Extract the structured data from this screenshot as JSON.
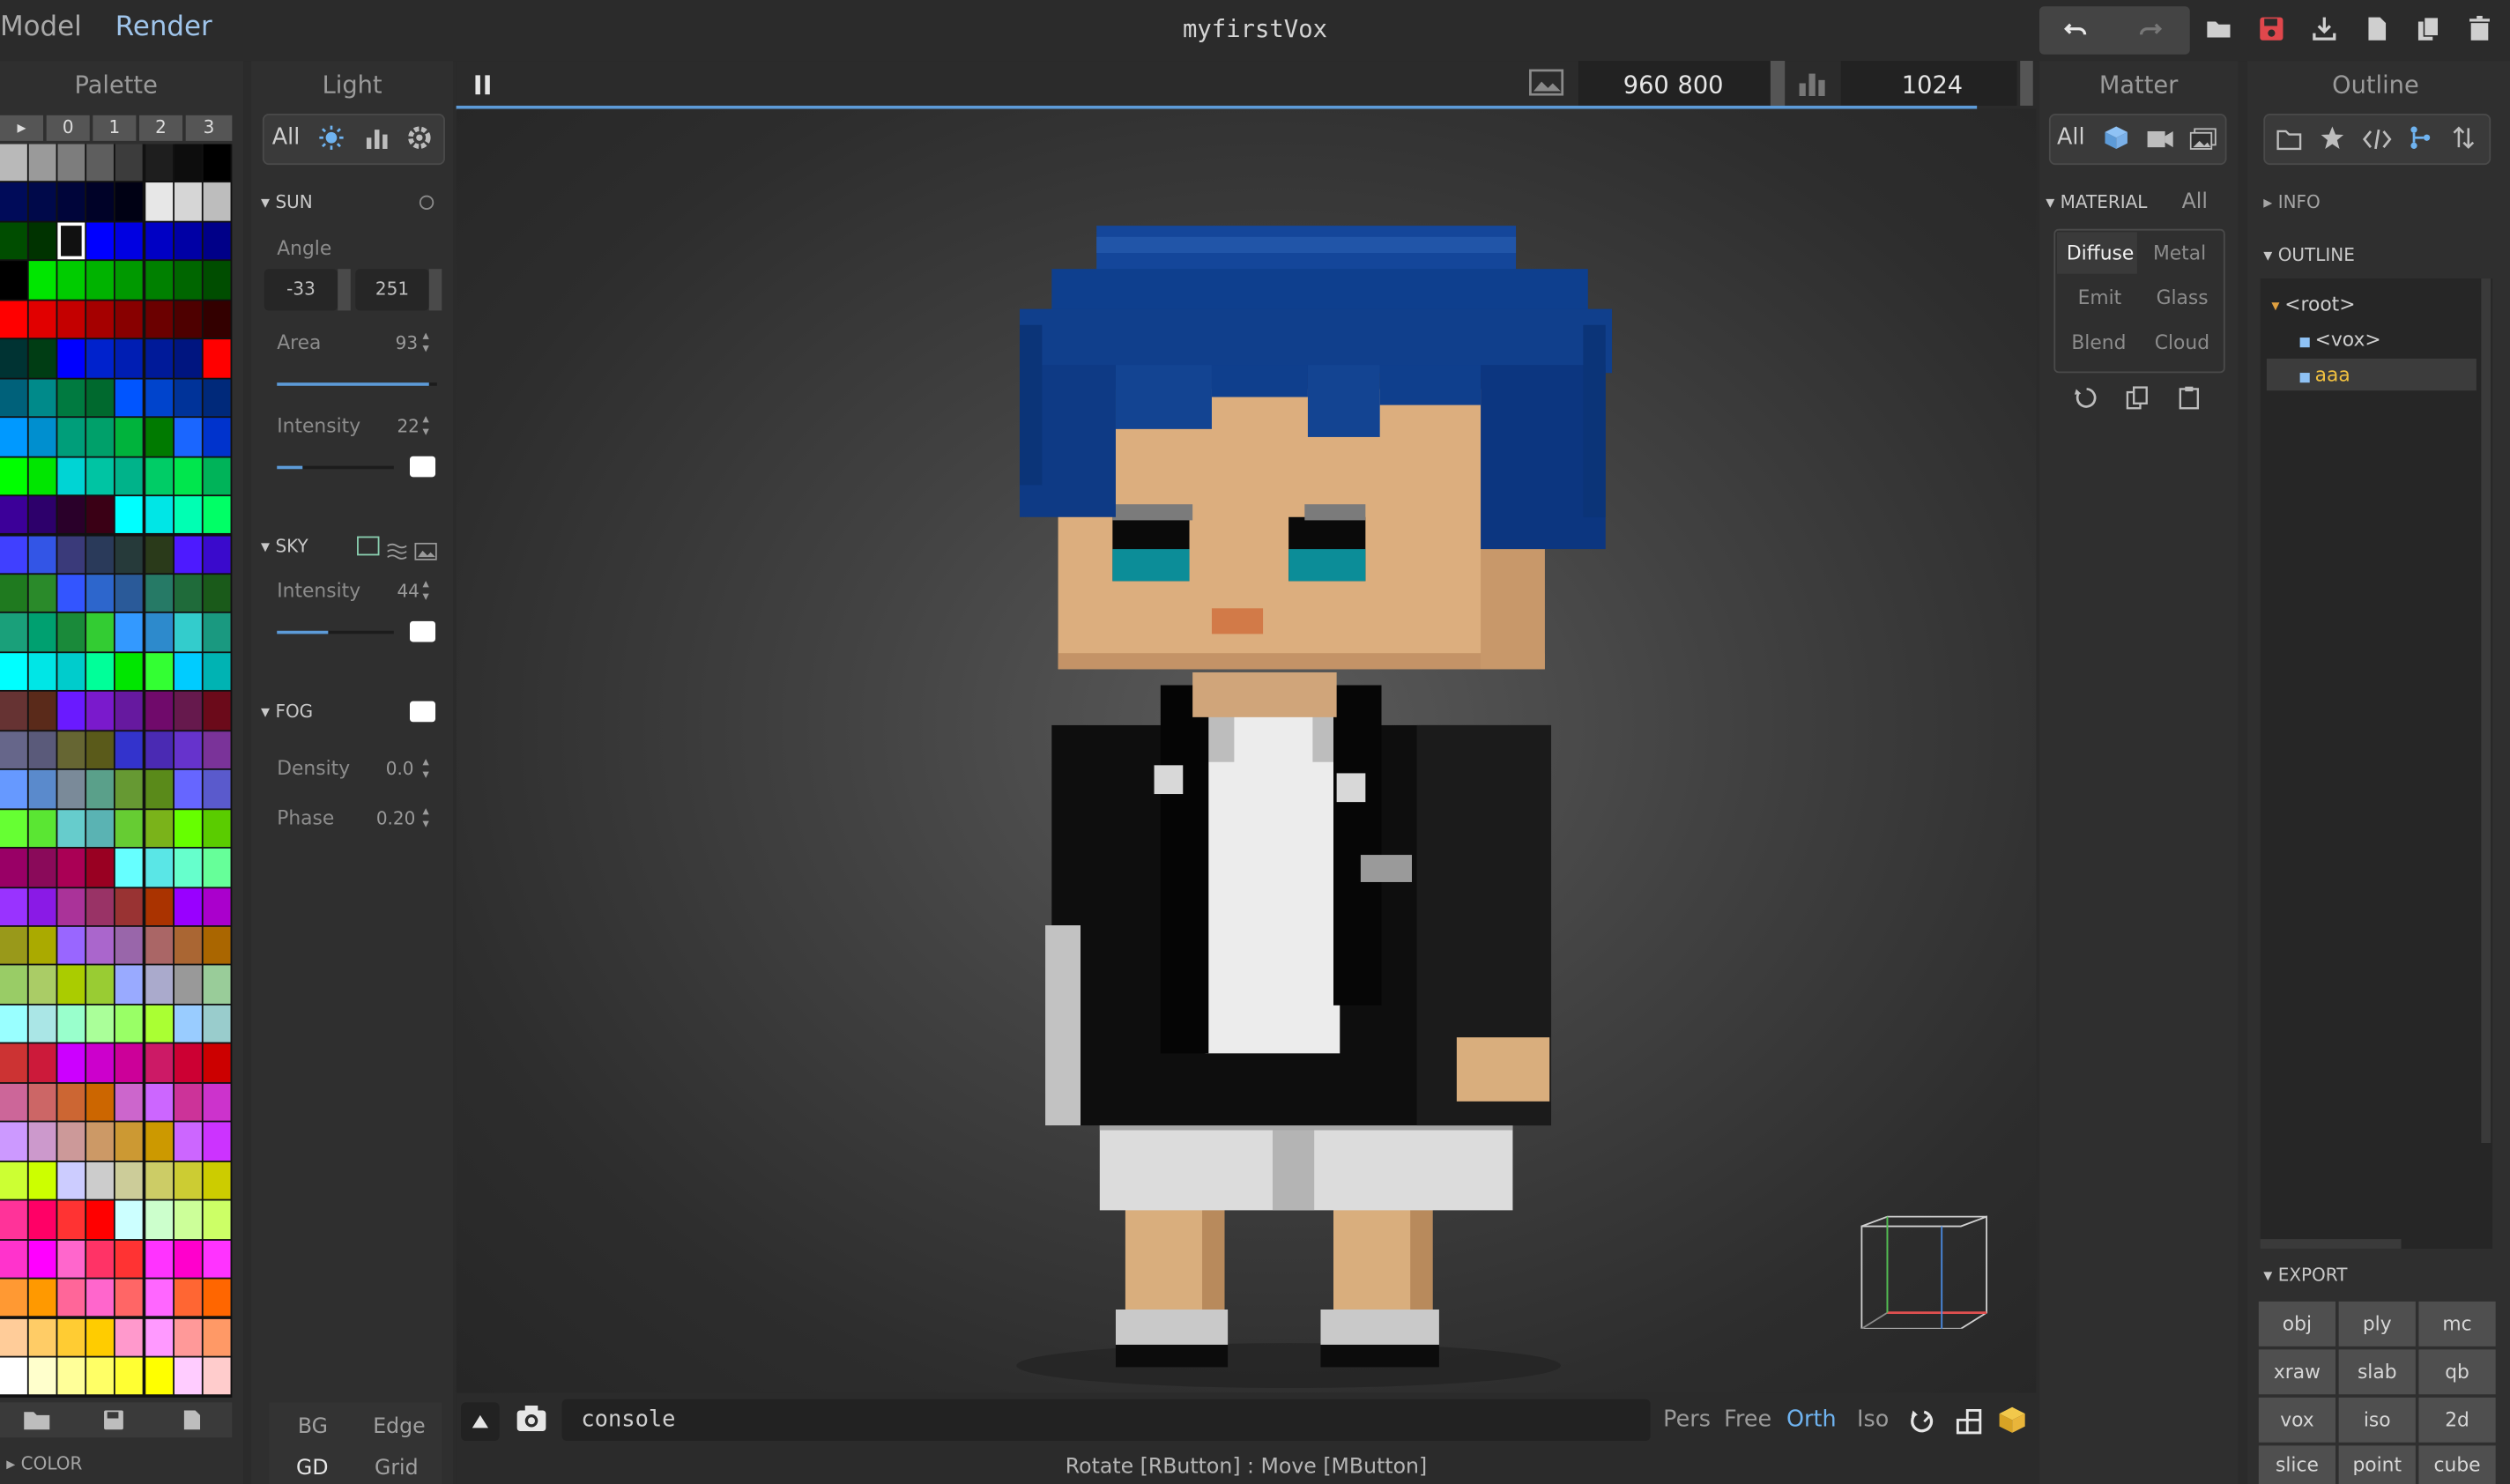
{
  "menu": {
    "model": "Model",
    "render": "Render"
  },
  "doc_title": "myfirstVox",
  "toolbar": {
    "undo_icon": "undo-icon",
    "redo_icon": "redo-icon",
    "open_icon": "folder-open-icon",
    "save_icon": "save-icon",
    "import_icon": "download-icon",
    "new_icon": "new-file-icon",
    "copy_icon": "copy-file-icon",
    "delete_icon": "trash-icon",
    "save_color": "#e0474c"
  },
  "palette": {
    "title": "Palette",
    "tabs": [
      "▸",
      "0",
      "1",
      "2",
      "3"
    ],
    "selected_index": 18,
    "colors": [
      "#b9b9b9",
      "#9a9a9a",
      "#7d7d7d",
      "#5e5e5e",
      "#3c3c3c",
      "#1e1e1e",
      "#0d0d0d",
      "#000000",
      "#000b59",
      "#00094a",
      "#00053a",
      "#000228",
      "#000114",
      "#e7e7e7",
      "#d6d6d6",
      "#bdbdbd",
      "#004d00",
      "#003300",
      "#111111",
      "#0000ff",
      "#0000e1",
      "#0000c4",
      "#0000a5",
      "#000088",
      "#000000",
      "#00e600",
      "#00cc00",
      "#00b300",
      "#009900",
      "#008000",
      "#006600",
      "#004d00",
      "#ff0000",
      "#e10000",
      "#c40000",
      "#a50000",
      "#880000",
      "#6b0000",
      "#4e0000",
      "#330000",
      "#003333",
      "#003d14",
      "#0000ff",
      "#0022cc",
      "#001eb3",
      "#001a99",
      "#001580",
      "#ff0000",
      "#00617a",
      "#008a8a",
      "#007a40",
      "#00692e",
      "#0055ff",
      "#0044cc",
      "#003399",
      "#00297a",
      "#0099ff",
      "#008fcf",
      "#009e7a",
      "#00a06a",
      "#00b33c",
      "#007a00",
      "#1a66ff",
      "#0033cc",
      "#00ff00",
      "#00e600",
      "#00d4d4",
      "#00c4a3",
      "#00b38a",
      "#00cc66",
      "#00e64d",
      "#00b359",
      "#3c0099",
      "#2d006b",
      "#2a002a",
      "#3a0015",
      "#00ffff",
      "#00e6e6",
      "#00ffb3",
      "#00ff66",
      "#4040ff",
      "#3355e6",
      "#3a3a7a",
      "#2a3a5a",
      "#263a3a",
      "#2a3a1a",
      "#4d1aff",
      "#3a0acc",
      "#1f7a1f",
      "#2a8a2a",
      "#3355ff",
      "#2d66cc",
      "#2a5a99",
      "#267a66",
      "#1f6b3a",
      "#1a5a1a",
      "#1aa07a",
      "#00a070",
      "#1a8a3a",
      "#33cc33",
      "#3399ff",
      "#2d8acc",
      "#33cccc",
      "#1a9980",
      "#00ffff",
      "#00e6e6",
      "#00cccc",
      "#00ff99",
      "#00e600",
      "#33ff33",
      "#00ccff",
      "#00b3b3",
      "#663333",
      "#5a2a1a",
      "#6a1aff",
      "#7a1acc",
      "#66199f",
      "#700a6b",
      "#66194d",
      "#6b0a1a",
      "#66668a",
      "#5a5a7a",
      "#666633",
      "#5a5a1a",
      "#3333cc",
      "#4a2ab3",
      "#6633cc",
      "#7a3399",
      "#6699ff",
      "#5a8acc",
      "#7a8a99",
      "#5aa08a",
      "#669933",
      "#5a8a1a",
      "#6666ff",
      "#5a5acc",
      "#66ff33",
      "#5ae633",
      "#66cccc",
      "#5ab3b3",
      "#66cc33",
      "#7ab31a",
      "#66ff00",
      "#5acc00",
      "#990066",
      "#8a0a5a",
      "#aa0055",
      "#990022",
      "#66ffff",
      "#5ae6e6",
      "#66ffcc",
      "#66ff99",
      "#9933ff",
      "#8a1ae6",
      "#aa3399",
      "#993366",
      "#993333",
      "#aa3300",
      "#9900ff",
      "#aa00cc",
      "#99991a",
      "#aaaa00",
      "#9966ff",
      "#aa66cc",
      "#9966aa",
      "#aa6666",
      "#aa6633",
      "#aa6600",
      "#99cc66",
      "#aacc66",
      "#aacc00",
      "#99cc33",
      "#99aaff",
      "#aaaacc",
      "#999999",
      "#99cc99",
      "#99ffff",
      "#aae6e6",
      "#99ffcc",
      "#aaff99",
      "#99ff66",
      "#aaff33",
      "#99ccff",
      "#99cccc",
      "#cc3333",
      "#cc1a3a",
      "#cc00ff",
      "#cc00cc",
      "#cc0099",
      "#cc1a66",
      "#cc0033",
      "#cc0000",
      "#cc6699",
      "#cc6666",
      "#cc6633",
      "#cc6600",
      "#cc66cc",
      "#cc66ff",
      "#cc3399",
      "#cc33cc",
      "#cc99ff",
      "#cc99cc",
      "#cc9999",
      "#cc9966",
      "#cc9933",
      "#cc9900",
      "#cc66ff",
      "#cc33ff",
      "#ccff33",
      "#ccff00",
      "#ccccff",
      "#cccccc",
      "#cccc99",
      "#cccc66",
      "#cccc33",
      "#cccc00",
      "#ff3399",
      "#ff0066",
      "#ff3333",
      "#ff0000",
      "#ccffff",
      "#ccffcc",
      "#ccff99",
      "#ccff66",
      "#ff33cc",
      "#ff00ff",
      "#ff66cc",
      "#ff3366",
      "#ff3333",
      "#ff33ff",
      "#ff00cc",
      "#ff33ff",
      "#ff9933",
      "#ff9900",
      "#ff6699",
      "#ff66cc",
      "#ff6666",
      "#ff66ff",
      "#ff6633",
      "#ff6600",
      "#ffcc99",
      "#ffcc66",
      "#ffcc33",
      "#ffcc00",
      "#ff99cc",
      "#ff99ff",
      "#ff9999",
      "#ff9966",
      "#ffffff",
      "#ffffcc",
      "#ffff99",
      "#ffff66",
      "#ffff33",
      "#ffff00",
      "#ffccff",
      "#ffcccc"
    ],
    "footer": {
      "open_icon": "folder-icon",
      "save_icon": "save-icon",
      "new_icon": "file-icon"
    },
    "section_color": "COLOR"
  },
  "light": {
    "title": "Light",
    "filter": {
      "all": "All",
      "sun_icon": "sun-icon",
      "chart_icon": "bar-chart-icon",
      "settings_icon": "gear-icon"
    },
    "sun": {
      "label": "SUN",
      "toggle_icon": "circle-icon",
      "angle_label": "Angle",
      "angle_a": "-33",
      "angle_b": "251",
      "area_label": "Area",
      "area_value": "93",
      "area_level": 0.95,
      "intensity_label": "Intensity",
      "intensity_value": "22",
      "intensity_level": 0.22
    },
    "sky": {
      "label": "SKY",
      "icons": [
        "square-icon",
        "waves-icon",
        "image-icon"
      ],
      "intensity_label": "Intensity",
      "intensity_value": "44",
      "intensity_level": 0.44
    },
    "fog": {
      "label": "FOG",
      "density_label": "Density",
      "density_value": "0.0",
      "phase_label": "Phase",
      "phase_value": "0.20"
    },
    "bottom_tabs": {
      "bg": "BG",
      "edge": "Edge",
      "gd": "GD",
      "grid": "Grid"
    }
  },
  "render": {
    "pause_icon": "pause-icon",
    "image_icon": "image-icon",
    "width": "960",
    "height": "800",
    "stats_icon": "bar-chart-icon",
    "samples": "1024",
    "progress": 1.0,
    "console_placeholder": "console",
    "modes": [
      "Pers",
      "Free",
      "Orth",
      "Iso"
    ],
    "active_mode": "Orth",
    "hint": "Rotate [RButton] : Move [MButton]"
  },
  "matter": {
    "title": "Matter",
    "filter": {
      "all": "All",
      "cube_icon": "cube-icon",
      "camera_icon": "camera-icon",
      "image_icon": "image-icon"
    },
    "material_label": "MATERIAL",
    "material_all": "All",
    "types": [
      "Diffuse",
      "Metal",
      "Emit",
      "Glass",
      "Blend",
      "Cloud"
    ],
    "active_type": "Diffuse",
    "actions": [
      "reset-icon",
      "copy-icon",
      "paste-icon"
    ]
  },
  "outline": {
    "title": "Outline",
    "toolbar": [
      "folder-icon",
      "star-icon",
      "code-icon",
      "branch-icon",
      "sort-icon"
    ],
    "info_label": "INFO",
    "outline_label": "OUTLINE",
    "tree": {
      "root": "<root>",
      "child1": "<vox>",
      "child2": "aaa"
    },
    "export_label": "EXPORT",
    "export_buttons": [
      "obj",
      "ply",
      "mc",
      "xraw",
      "slab",
      "qb",
      "vox",
      "iso",
      "2d",
      "slice",
      "point",
      "cube"
    ]
  }
}
